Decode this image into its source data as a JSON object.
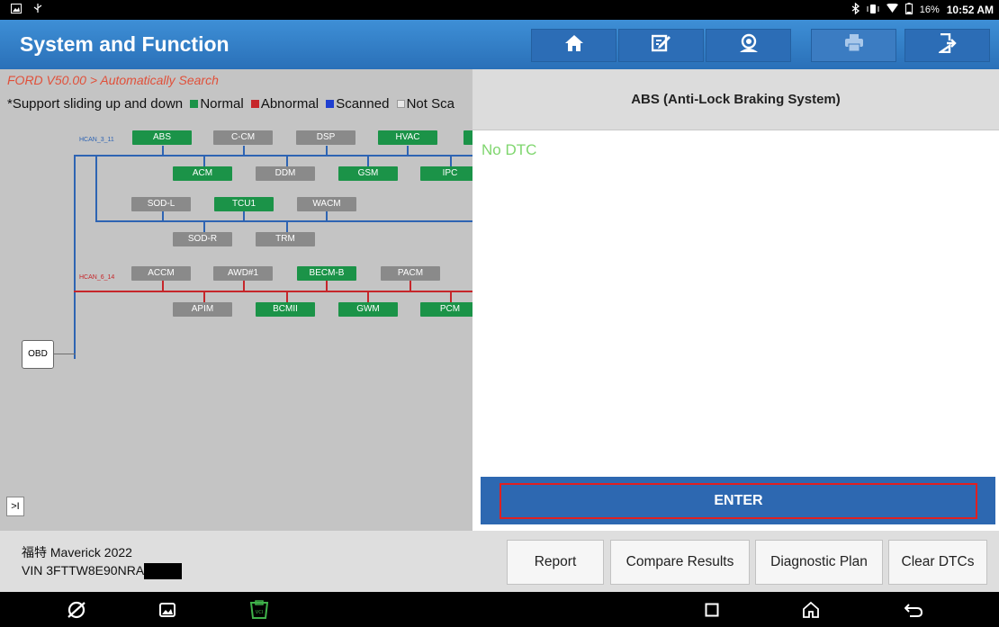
{
  "status_bar": {
    "battery": "16%",
    "time": "10:52 AM"
  },
  "header": {
    "title": "System and Function",
    "nav": [
      "home-icon",
      "edit-icon",
      "support-icon",
      "print-icon",
      "exit-icon"
    ]
  },
  "left": {
    "breadcrumb": "FORD V50.00 > Automatically Search",
    "legend": {
      "prefix": "*Support sliding up and down",
      "normal": "Normal",
      "abnormal": "Abnormal",
      "scanned": "Scanned",
      "not_scanned": "Not Sca"
    },
    "topology": {
      "bus1_label": "HCAN_3_11",
      "bus2_label": "HCAN_6_14",
      "modules": {
        "abs": "ABS",
        "ccm": "C-CM",
        "dsp": "DSP",
        "hvac": "HVAC",
        "acm": "ACM",
        "ddm": "DDM",
        "gsm": "GSM",
        "ipc": "IPC",
        "sodl": "SOD-L",
        "tcu1": "TCU1",
        "wacm": "WACM",
        "sodr": "SOD-R",
        "trm": "TRM",
        "accm": "ACCM",
        "awd": "AWD#1",
        "becm": "BECM-B",
        "pacm": "PACM",
        "apim": "APIM",
        "bcmii": "BCMII",
        "gwm": "GWM",
        "pcm": "PCM"
      },
      "obd_label": "OBD"
    },
    "collapse_label": ">I"
  },
  "right": {
    "system_title": "ABS (Anti-Lock Braking System)",
    "dtc_status": "No DTC",
    "enter_label": "ENTER"
  },
  "footer": {
    "vehicle_name": "福特 Maverick 2022",
    "vin": "VIN 3FTTW8E90NRA",
    "buttons": {
      "report": "Report",
      "compare": "Compare Results",
      "plan": "Diagnostic Plan",
      "clear": "Clear DTCs"
    }
  },
  "colors": {
    "normal": "#1b9348",
    "abnormal": "#c6262a",
    "scanned": "#1f3fd0",
    "header_blue": "#2f7cc8",
    "dtc_green": "#7fd66e"
  }
}
